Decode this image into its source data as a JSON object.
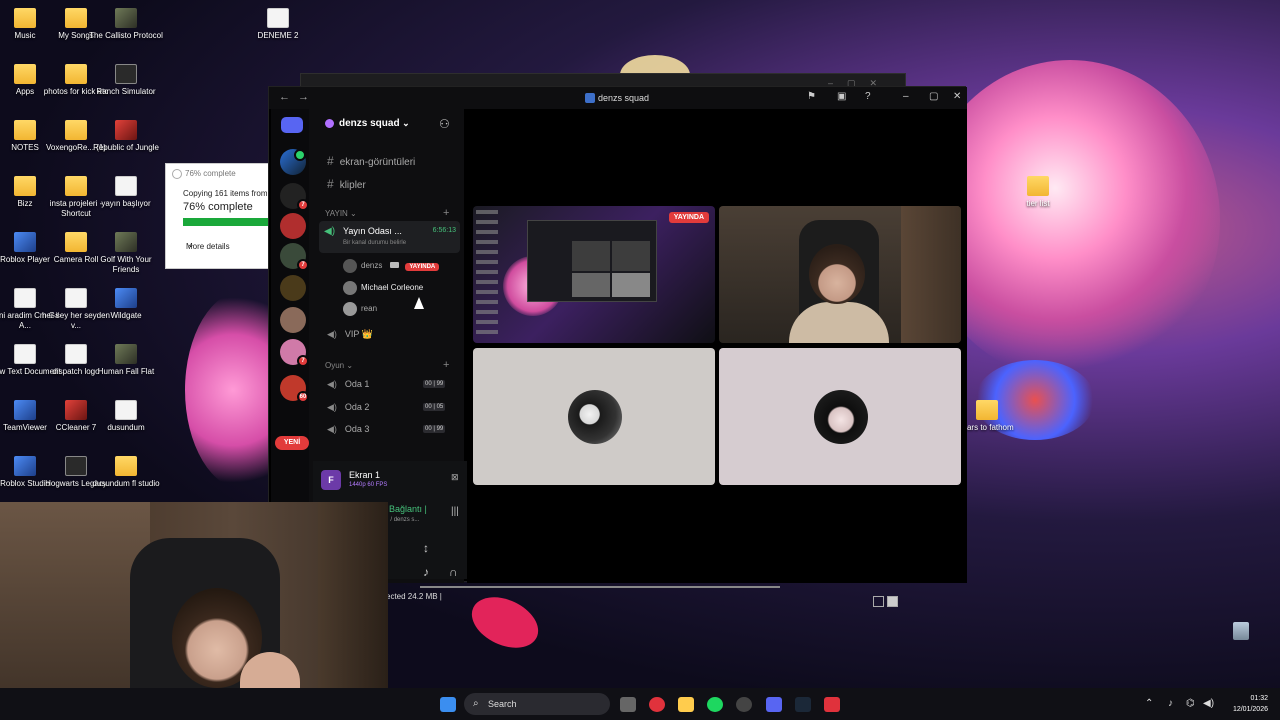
{
  "desktop": {
    "icons": [
      {
        "label": "Music",
        "icon": "folder-icon"
      },
      {
        "label": "My Songs",
        "icon": "folder-icon"
      },
      {
        "label": "The Callisto Protocol",
        "icon": "game-icon"
      },
      {
        "label": "DENEME 2",
        "icon": "document-icon"
      },
      {
        "label": "Apps",
        "icon": "folder-icon"
      },
      {
        "label": "photos for kick etc",
        "icon": "folder-icon"
      },
      {
        "label": "Ranch Simulator",
        "icon": "game-icon"
      },
      {
        "label": "NOTES",
        "icon": "folder-icon"
      },
      {
        "label": "VoxengoRe... (1)",
        "icon": "folder-icon"
      },
      {
        "label": "Republic of Jungle",
        "icon": "game-icon"
      },
      {
        "label": "Bizz",
        "icon": "folder-icon"
      },
      {
        "label": "insta projeleri - Shortcut",
        "icon": "folder-icon"
      },
      {
        "label": "yayın başlıyor",
        "icon": "document-icon"
      },
      {
        "label": "Roblox Player",
        "icon": "app-icon"
      },
      {
        "label": "Camera Roll",
        "icon": "folder-icon"
      },
      {
        "label": "Golf With Your Friends",
        "icon": "game-icon"
      },
      {
        "label": "seni aradim Cm G# A...",
        "icon": "document-icon"
      },
      {
        "label": "her sey her seyden v...",
        "icon": "document-icon"
      },
      {
        "label": "Wildgate",
        "icon": "game-icon"
      },
      {
        "label": "New Text Document",
        "icon": "document-icon"
      },
      {
        "label": "dispatch logo",
        "icon": "document-icon"
      },
      {
        "label": "Human Fall Flat",
        "icon": "game-icon"
      },
      {
        "label": "TeamViewer",
        "icon": "app-icon"
      },
      {
        "label": "CCleaner 7",
        "icon": "app-icon"
      },
      {
        "label": "dusundum",
        "icon": "app-icon"
      },
      {
        "label": "Roblox Studio",
        "icon": "app-icon"
      },
      {
        "label": "Hogwarts Legacy",
        "icon": "game-icon"
      },
      {
        "label": "dusundum fl studio",
        "icon": "folder-icon"
      },
      {
        "label": "tier list",
        "icon": "folder-icon"
      },
      {
        "label": "fears to fathom",
        "icon": "folder-icon"
      }
    ]
  },
  "copy_dialog": {
    "title": "76% complete",
    "status": "Copying 161 items from",
    "percent_text": "76% complete",
    "progress": 0.76,
    "more_details": "More details"
  },
  "discord": {
    "window_title": "denzs squad",
    "server_name": "denzs squad",
    "channels": [
      {
        "name": "ekran-görüntüleri"
      },
      {
        "name": "klipler"
      }
    ],
    "category_yayin": "YAYIN",
    "voice_channel": {
      "name": "Yayın Odası ...",
      "timer": "6:56:13",
      "status": "Bir kanal durumu belirle"
    },
    "members": [
      {
        "name": "denzs",
        "live": "YAYINDA"
      },
      {
        "name": "Michael Corleone"
      },
      {
        "name": "rean"
      }
    ],
    "vip": "VIP 👑",
    "category_oyun": "Oyun",
    "voice_rooms": [
      {
        "name": "Oda 1",
        "count": "00 | 99"
      },
      {
        "name": "Oda 2",
        "count": "00 | 05"
      },
      {
        "name": "Oda 3",
        "count": "00 | 99"
      }
    ],
    "server_badges": [
      "7",
      "7",
      "7",
      "60"
    ],
    "new_label": "YENİ",
    "stream_panel": {
      "initial": "F",
      "title": "Ekran 1",
      "quality": "1440p 60 FPS"
    },
    "connection": {
      "title": "Görüntülü Bağlantı |",
      "subtitle": "Yayın Odası 👑 / denzs s..."
    },
    "stage_live_badge": "YAYINDA"
  },
  "explorer": {
    "status_text": "ected  24.2 MB  |"
  },
  "taskbar": {
    "search_placeholder": "Search",
    "time": "01:32",
    "date": "12/01/2026"
  },
  "colors": {
    "discord_bg": "#000000",
    "live_red": "#e23b3b",
    "voice_green": "#45c07a",
    "progress_green": "#1aa83a"
  }
}
